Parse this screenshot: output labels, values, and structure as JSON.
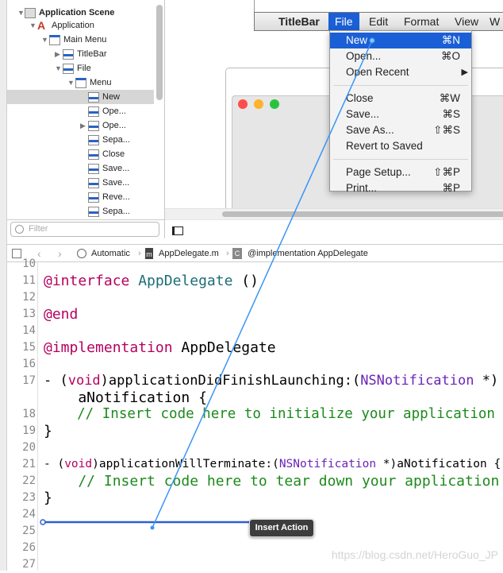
{
  "outline": {
    "items": [
      {
        "label": "Application Scene",
        "bold": true,
        "icon": "scene-icon",
        "expanded": true
      },
      {
        "label": "Application",
        "icon": "application-icon",
        "expanded": true
      },
      {
        "label": "Main Menu",
        "icon": "menu-icon",
        "expanded": true
      },
      {
        "label": "TitleBar",
        "icon": "menu-item-icon",
        "expanded": false
      },
      {
        "label": "File",
        "icon": "menu-item-icon",
        "expanded": true
      },
      {
        "label": "Menu",
        "icon": "menu-icon",
        "expanded": true
      },
      {
        "label": "New",
        "icon": "menu-item-icon",
        "selected": true
      },
      {
        "label": "Ope...",
        "icon": "menu-item-icon"
      },
      {
        "label": "Ope...",
        "icon": "menu-item-icon",
        "expanded": false
      },
      {
        "label": "Sepa...",
        "icon": "menu-item-icon"
      },
      {
        "label": "Close",
        "icon": "menu-item-icon"
      },
      {
        "label": "Save...",
        "icon": "menu-item-icon"
      },
      {
        "label": "Save...",
        "icon": "menu-item-icon"
      },
      {
        "label": "Reve...",
        "icon": "menu-item-icon"
      },
      {
        "label": "Sepa...",
        "icon": "menu-item-icon"
      }
    ],
    "filter_placeholder": "Filter"
  },
  "menubar": {
    "items": [
      "TitleBar",
      "File",
      "Edit",
      "Format",
      "View",
      "W"
    ],
    "active": "File"
  },
  "file_menu": [
    {
      "label": "New",
      "shortcut": "⌘N",
      "highlighted": true
    },
    {
      "label": "Open...",
      "shortcut": "⌘O"
    },
    {
      "label": "Open Recent",
      "submenu": true,
      "shortcut": "▶"
    },
    {
      "separator": true
    },
    {
      "label": "Close",
      "shortcut": "⌘W"
    },
    {
      "label": "Save...",
      "shortcut": "⌘S"
    },
    {
      "label": "Save As...",
      "shortcut": "⇧⌘S"
    },
    {
      "label": "Revert to Saved",
      "shortcut": ""
    },
    {
      "separator": true
    },
    {
      "label": "Page Setup...",
      "shortcut": "⇧⌘P"
    },
    {
      "label": "Print...",
      "shortcut": "⌘P"
    }
  ],
  "jumpbar": {
    "mode": "Automatic",
    "file": "AppDelegate.m",
    "symbol": "@implementation AppDelegate"
  },
  "code": {
    "first_line": 10,
    "lines": [
      {
        "n": "10",
        "t": []
      },
      {
        "n": "11",
        "t": [
          [
            "kw",
            "@interface"
          ],
          [
            "",
            ""
          ],
          [
            "",
            " "
          ],
          [
            "cls",
            "AppDelegate"
          ],
          [
            "",
            " ()"
          ]
        ]
      },
      {
        "n": "12",
        "t": []
      },
      {
        "n": "13",
        "t": [
          [
            "kw",
            "@end"
          ]
        ]
      },
      {
        "n": "14",
        "t": []
      },
      {
        "n": "15",
        "t": [
          [
            "kw",
            "@implementation"
          ],
          [
            "",
            " AppDelegate"
          ]
        ]
      },
      {
        "n": "16",
        "t": []
      },
      {
        "n": "17",
        "t": [
          [
            "",
            "- ("
          ],
          [
            "kw",
            "void"
          ],
          [
            "",
            ")applicationDidFinishLaunching:("
          ],
          [
            "ty",
            "NSNotification"
          ],
          [
            "",
            " *)"
          ]
        ]
      },
      {
        "n": "",
        "t": [
          [
            "",
            "    aNotification {"
          ]
        ]
      },
      {
        "n": "18",
        "t": [
          [
            "cm",
            "    // Insert code here to initialize your application"
          ]
        ]
      },
      {
        "n": "19",
        "t": [
          [
            "",
            "}"
          ]
        ]
      },
      {
        "n": "20",
        "t": []
      },
      {
        "n": "21",
        "t": [
          [
            "",
            "- ("
          ],
          [
            "kw",
            "void"
          ],
          [
            "",
            ")applicationWillTerminate:("
          ],
          [
            "ty",
            "NSNotification"
          ],
          [
            "",
            " *)aNotification {"
          ]
        ]
      },
      {
        "n": "22",
        "t": [
          [
            "cm",
            "    // Insert code here to tear down your application"
          ]
        ]
      },
      {
        "n": "23",
        "t": [
          [
            "",
            "}"
          ]
        ]
      },
      {
        "n": "24",
        "t": []
      },
      {
        "n": "25",
        "t": []
      },
      {
        "n": "26",
        "t": []
      },
      {
        "n": "27",
        "t": []
      }
    ]
  },
  "tooltip": "Insert Action",
  "watermark": "https://blog.csdn.net/HeroGuo_JP",
  "colors": {
    "accent": "#1b5fd6",
    "connection": "#3b95f5",
    "insert_line": "#2f5fd0",
    "keyword": "#b5005f",
    "type": "#6b23b7",
    "comment": "#1c8a1c"
  }
}
